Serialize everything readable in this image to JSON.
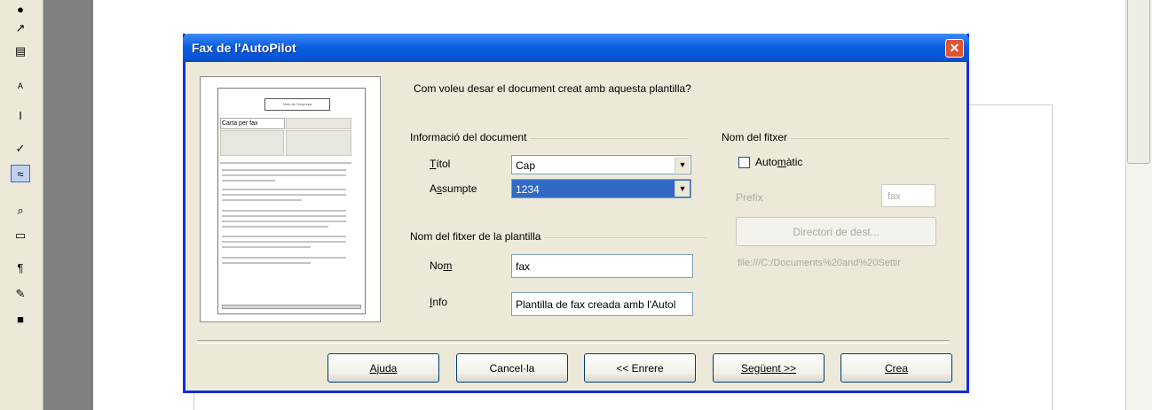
{
  "toolbar_left": {
    "icons": [
      "draw-icon",
      "insert-object-icon",
      "navigator-icon",
      "text-cursor-icon",
      "spellcheck-icon",
      "autospell-icon",
      "find-icon",
      "gallery-icon",
      "nonprinting-chars-icon",
      "datasource-icon",
      "macro-icon"
    ]
  },
  "dialog": {
    "title": "Fax de l'AutoPilot",
    "close_symbol": "✕",
    "question": "Com voleu desar el document creat amb aquesta plantilla?",
    "preview": {
      "header_text": "Nom de l'empresa",
      "fax_label": "Carta per fax"
    },
    "doc_info": {
      "group_title": "Informació del document",
      "title_label": "Títol",
      "title_value": "Cap",
      "subject_label": "Assumpte",
      "subject_value": "1234"
    },
    "template_file": {
      "group_title": "Nom del fitxer de la plantilla",
      "name_label": "Nom",
      "name_value": "fax",
      "info_label": "Info",
      "info_value": "Plantilla de fax creada amb l'Autol"
    },
    "filename": {
      "group_title": "Nom del fitxer",
      "auto_label": "Automàtic",
      "auto_checked": false,
      "prefix_label": "Prefix",
      "prefix_value": "fax",
      "dir_button": "Directori de dest...",
      "path": "file:///C:/Documents%20and%20Settir"
    },
    "buttons": {
      "help": "Ajuda",
      "cancel": "Cancel·la",
      "back": "<< Enrere",
      "next": "Següent >>",
      "create": "Crea"
    }
  }
}
